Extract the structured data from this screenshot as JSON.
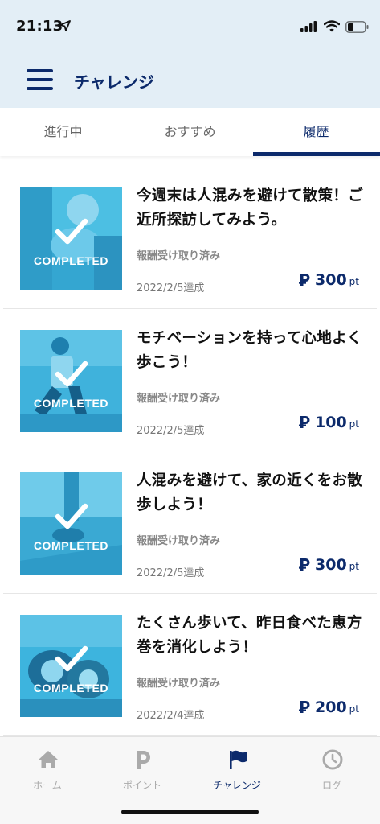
{
  "status_bar": {
    "time": "21:13"
  },
  "nav": {
    "title": "チャレンジ",
    "menu_icon": "hamburger-menu-icon"
  },
  "tabs": [
    {
      "label": "進行中",
      "active": false
    },
    {
      "label": "おすすめ",
      "active": false
    },
    {
      "label": "履歴",
      "active": true
    }
  ],
  "challenges": [
    {
      "title": "今週末は人混みを避けて散策！ご近所探訪してみよう。",
      "status": "報酬受け取り済み",
      "date": "2022/2/5達成",
      "points": "300",
      "unit": "pt",
      "badge": "COMPLETED"
    },
    {
      "title": "モチベーションを持って心地よく歩こう！",
      "status": "報酬受け取り済み",
      "date": "2022/2/5達成",
      "points": "100",
      "unit": "pt",
      "badge": "COMPLETED"
    },
    {
      "title": "人混みを避けて、家の近くをお散歩しよう！",
      "status": "報酬受け取り済み",
      "date": "2022/2/5達成",
      "points": "300",
      "unit": "pt",
      "badge": "COMPLETED"
    },
    {
      "title": "たくさん歩いて、昨日食べた恵方巻を消化しよう！",
      "status": "報酬受け取り済み",
      "date": "2022/2/4達成",
      "points": "200",
      "unit": "pt",
      "badge": "COMPLETED"
    }
  ],
  "tabbar": [
    {
      "label": "ホーム",
      "icon": "home-icon",
      "active": false
    },
    {
      "label": "ポイント",
      "icon": "point-icon",
      "active": false
    },
    {
      "label": "チャレンジ",
      "icon": "flag-icon",
      "active": true
    },
    {
      "label": "ログ",
      "icon": "clock-icon",
      "active": false
    }
  ],
  "colors": {
    "brand": "#0c2a6b",
    "header_bg": "#e3eef6",
    "thumb_tint": "#3fb6dc"
  }
}
